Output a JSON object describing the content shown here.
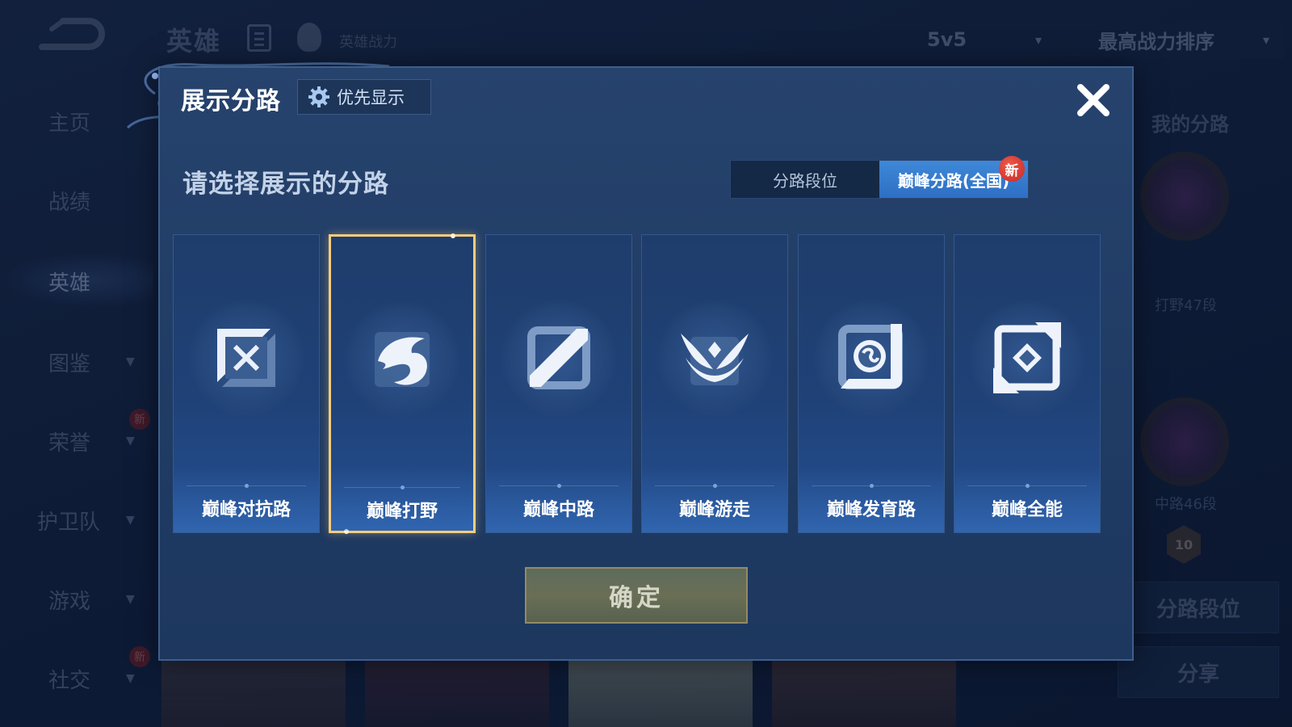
{
  "background": {
    "title": "英雄",
    "subtitle": "英雄战力",
    "mode_select": "5v5",
    "sort_select": "最高战力排序",
    "nav": [
      {
        "label": "主页"
      },
      {
        "label": "战绩"
      },
      {
        "label": "英雄"
      },
      {
        "label": "图鉴"
      },
      {
        "label": "荣誉"
      },
      {
        "label": "护卫队"
      },
      {
        "label": "游戏"
      },
      {
        "label": "社交"
      }
    ],
    "new_badge": "新",
    "right_panel": {
      "title": "我的分路",
      "rank1": "打野47段",
      "rank2": "中路46段",
      "level": "10",
      "lane_rank_button": "分路段位",
      "share_button": "分享"
    }
  },
  "modal": {
    "title": "展示分路",
    "priority_button": "优先显示",
    "prompt": "请选择展示的分路",
    "toggle": {
      "options": [
        {
          "label": "分路段位"
        },
        {
          "label": "巅峰分路(全国)"
        }
      ],
      "selected_index": 1,
      "badge": "新"
    },
    "lanes": [
      {
        "label": "巅峰对抗路",
        "icon": "clash-lane-icon"
      },
      {
        "label": "巅峰打野",
        "icon": "jungle-dragon-icon"
      },
      {
        "label": "巅峰中路",
        "icon": "mid-lane-icon"
      },
      {
        "label": "巅峰游走",
        "icon": "roam-wings-icon"
      },
      {
        "label": "巅峰发育路",
        "icon": "farm-lane-icon"
      },
      {
        "label": "巅峰全能",
        "icon": "all-round-icon"
      }
    ],
    "selected_lane_index": 1,
    "confirm_button": "确定"
  },
  "colors": {
    "modal_bg": "#223f69",
    "selected_border": "#f5cd7e",
    "toggle_active": "#3a80d4",
    "confirm_bg": "#646b56"
  }
}
